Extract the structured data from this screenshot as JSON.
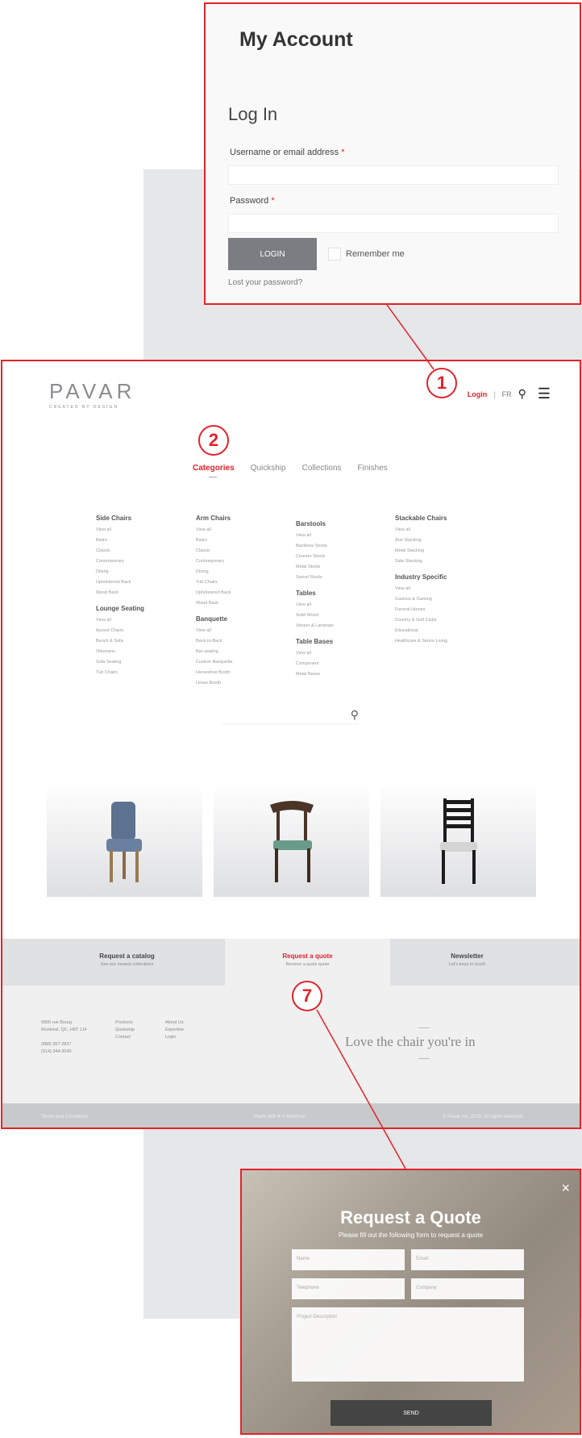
{
  "login_panel": {
    "title": "My Account",
    "form_title": "Log In",
    "username_label": "Username or email address",
    "password_label": "Password",
    "required_mark": "*",
    "login_button": "LOGIN",
    "remember_label": "Remember me",
    "lost_password": "Lost your password?"
  },
  "header": {
    "logo": "PAVAR",
    "tagline": "CREATED BY DESIGN",
    "login": "Login",
    "separator": "|",
    "lang": "FR",
    "search_icon": "search-icon",
    "menu_icon": "hamburger-icon"
  },
  "tabs": [
    "Categories",
    "Quickship",
    "Collections",
    "Finishes"
  ],
  "categories": {
    "col1": [
      {
        "head": "Side Chairs",
        "items": [
          "View all",
          "Bistro",
          "Classic",
          "Contemporary",
          "Dining",
          "Upholstered Back",
          "Wood Back"
        ]
      },
      {
        "head": "Lounge Seating",
        "items": [
          "View all",
          "Accent Chairs",
          "Bench & Sofa",
          "Ottomans",
          "Sofa Seating",
          "Tub Chairs"
        ]
      }
    ],
    "col2": [
      {
        "head": "Arm Chairs",
        "items": [
          "View all",
          "Bistro",
          "Classic",
          "Contemporary",
          "Dining",
          "Tub Chairs",
          "Upholstered Back",
          "Wood Back"
        ]
      },
      {
        "head": "Banquette",
        "items": [
          "View all",
          "Back-to-Back",
          "Bar seating",
          "Custom Banquette",
          "Horseshoe Booth",
          "Linear Booth"
        ]
      }
    ],
    "col3": [
      {
        "head": "Barstools",
        "items": [
          "View all",
          "Backless Stools",
          "Counter Stools",
          "Metal Stools",
          "Swivel Stools"
        ]
      },
      {
        "head": "Tables",
        "items": [
          "View all",
          "Solid Wood",
          "Veneer & Laminate"
        ]
      },
      {
        "head": "Table Bases",
        "items": [
          "View all",
          "Component",
          "Metal Bases"
        ]
      }
    ],
    "col4": [
      {
        "head": "Stackable Chairs",
        "items": [
          "View all",
          "Arm Stacking",
          "Metal Stacking",
          "Side Stacking"
        ]
      },
      {
        "head": "Industry Specific",
        "items": [
          "View all",
          "Casinos & Gaming",
          "Funeral Homes",
          "Country & Golf Clubs",
          "Educational",
          "Healthcare & Senior Living"
        ]
      }
    ]
  },
  "ctas": [
    {
      "title": "Request a catalog",
      "sub": "See our newest collections"
    },
    {
      "title": "Request a quote",
      "sub": "Receive a quick quote"
    },
    {
      "title": "Newsletter",
      "sub": "Let's keep in touch"
    }
  ],
  "footer": {
    "address": [
      "9900 rue Bourg",
      "Montréal, QC, H8T 1J4",
      "",
      "(888) 957-2827",
      "(514) 344-3040"
    ],
    "links1": [
      "Products",
      "Quickship",
      "Contact"
    ],
    "links2": [
      "About Us",
      "Expertise",
      "Login"
    ],
    "slogan": "Love the chair you're in",
    "bottom_left": "Terms and Conditions",
    "bottom_center": "Made with ♥ in Montreal",
    "bottom_right": "© Pavar Inc. 2020. All rights reserved."
  },
  "modal": {
    "close": "×",
    "title": "Request a Quote",
    "subtitle": "Please fill out the following form to request a quote",
    "name": "Name",
    "email": "Email",
    "telephone": "Telephone",
    "company": "Company",
    "description": "Project Description",
    "send": "SEND"
  },
  "markers": [
    "1",
    "2",
    "7"
  ],
  "colors": {
    "accent": "#e2232a",
    "button": "#7b7d82",
    "footer": "#f0f0f0"
  }
}
